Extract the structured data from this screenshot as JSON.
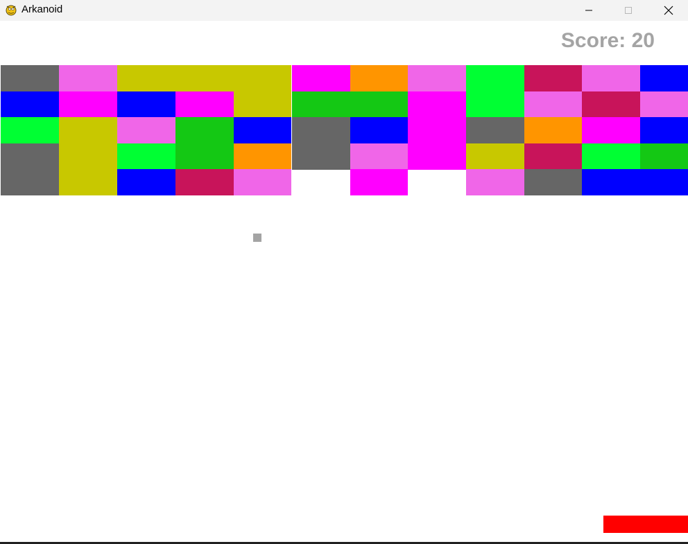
{
  "window": {
    "title": "Arkanoid",
    "app_icon": "pygame-snake-icon",
    "controls": [
      "minimize-icon",
      "maximize-icon",
      "close-icon"
    ]
  },
  "game": {
    "score_text": "Score: 20",
    "score_color": "#a4a4a4",
    "ball_color": "#a4a4a4",
    "paddle_color": "#ff0000",
    "brick_grid": {
      "columns": 12,
      "rows": 5,
      "rows_colors": [
        [
          "#666666",
          "#f066e8",
          "#c8c800",
          "#c8c800",
          "#c8c800",
          "#ff00ff",
          "#ff9500",
          "#f066e8",
          "#00ff33",
          "#c8145a",
          "#f066e8",
          "#0000ff"
        ],
        [
          "#0000ff",
          "#ff00ff",
          "#0000ff",
          "#ff00ff",
          "#c8c800",
          "#14c814",
          "#14c814",
          "#ff00ff",
          "#00ff33",
          "#f066e8",
          "#c8145a",
          "#f066e8"
        ],
        [
          "#00ff33",
          "#c8c800",
          "#f066e8",
          "#14c814",
          "#0000ff",
          "#666666",
          "#0000ff",
          "#ff00ff",
          "#666666",
          "#ff9500",
          "#ff00ff",
          "#0000ff"
        ],
        [
          "#666666",
          "#c8c800",
          "#00ff33",
          "#14c814",
          "#ff9500",
          "#666666",
          "#f066e8",
          "#ff00ff",
          "#c8c800",
          "#c8145a",
          "#00ff33",
          "#14c814"
        ],
        [
          "#666666",
          "#c8c800",
          "#0000ff",
          "#c8145a",
          "#f066e8",
          null,
          "#ff00ff",
          null,
          "#f066e8",
          "#666666",
          "#0000ff",
          "#0000ff"
        ]
      ]
    }
  }
}
